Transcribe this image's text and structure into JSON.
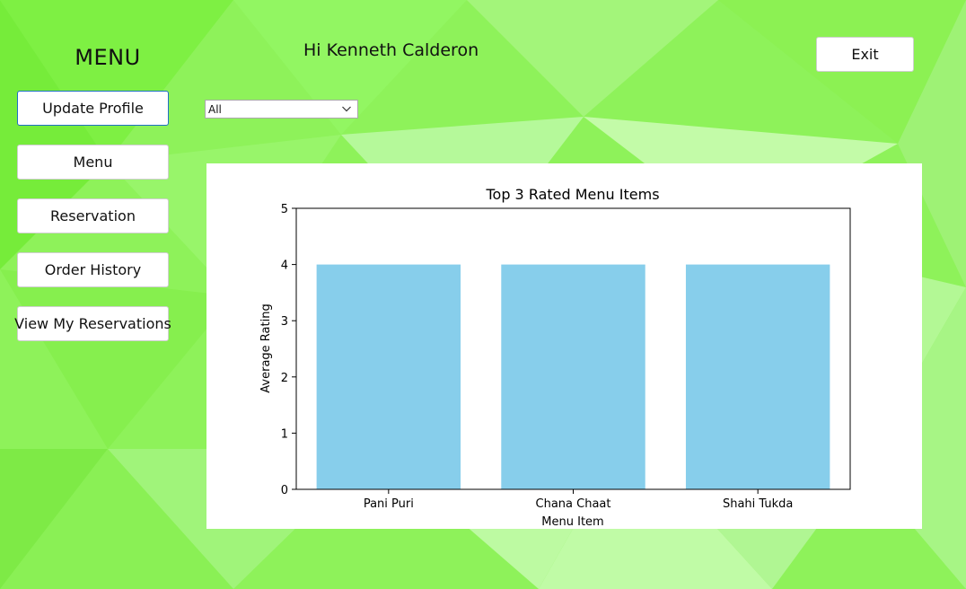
{
  "sidebar": {
    "heading": "MENU",
    "buttons": [
      {
        "label": "Update Profile",
        "active": true
      },
      {
        "label": "Menu",
        "active": false
      },
      {
        "label": "Reservation",
        "active": false
      },
      {
        "label": "Order History",
        "active": false
      },
      {
        "label": "View My Reservations",
        "active": false
      }
    ]
  },
  "header": {
    "greeting": "Hi Kenneth Calderon",
    "exit_label": "Exit"
  },
  "filter": {
    "selected": "All"
  },
  "colors": {
    "background": "#8ef25a",
    "bar_fill": "#87ceeb",
    "active_border": "#1f6fc4"
  },
  "icons": {
    "dropdown": "chevron-down-icon"
  },
  "chart_data": {
    "type": "bar",
    "title": "Top 3 Rated Menu Items",
    "xlabel": "Menu Item",
    "ylabel": "Average Rating",
    "categories": [
      "Pani Puri",
      "Chana Chaat",
      "Shahi Tukda"
    ],
    "values": [
      4,
      4,
      4
    ],
    "ylim": [
      0,
      5
    ],
    "yticks": [
      0,
      1,
      2,
      3,
      4,
      5
    ],
    "grid": false
  }
}
